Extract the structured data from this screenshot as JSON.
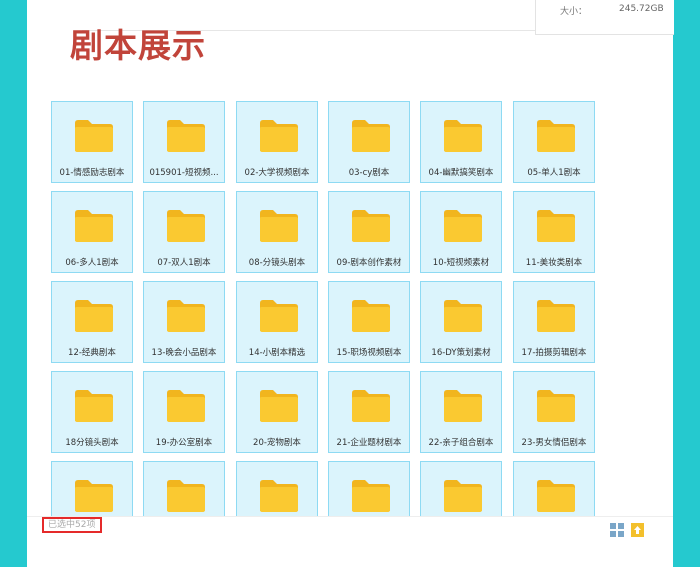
{
  "header": {
    "size_label": "大小：",
    "size_value": "245.72GB",
    "title": "剧本展示"
  },
  "folders": [
    {
      "label": "01-情感励志剧本"
    },
    {
      "label": "015901-短视频..."
    },
    {
      "label": "02-大学视频剧本"
    },
    {
      "label": "03-cy剧本"
    },
    {
      "label": "04-幽默搞笑剧本"
    },
    {
      "label": "05-单人1剧本"
    },
    {
      "label": "06-多人1剧本"
    },
    {
      "label": "07-双人1剧本"
    },
    {
      "label": "08-分镜头剧本"
    },
    {
      "label": "09-剧本创作素材"
    },
    {
      "label": "10-短视频素材"
    },
    {
      "label": "11-美妆类剧本"
    },
    {
      "label": "12-经典剧本"
    },
    {
      "label": "13-晚会小品剧本"
    },
    {
      "label": "14-小剧本精选"
    },
    {
      "label": "15-职场视频剧本"
    },
    {
      "label": "16-DY策划素材"
    },
    {
      "label": "17-拍摄剪辑剧本"
    },
    {
      "label": "18分镜头剧本"
    },
    {
      "label": "19-办公室剧本"
    },
    {
      "label": "20-宠物剧本"
    },
    {
      "label": "21-企业题材剧本"
    },
    {
      "label": "22-亲子组合剧本"
    },
    {
      "label": "23-男女情侣剧本"
    },
    {
      "label": ""
    },
    {
      "label": ""
    },
    {
      "label": ""
    },
    {
      "label": ""
    },
    {
      "label": ""
    },
    {
      "label": ""
    }
  ],
  "footer": {
    "status_text": "已选中52项",
    "grid_view_icon": "grid-view-icon",
    "upload_icon": "upload-icon"
  },
  "colors": {
    "background": "#25c9cf",
    "title": "#c1443a",
    "tile_bg": "#dbf4fc",
    "tile_border": "#8edaf3",
    "folder": "#f8c530",
    "highlight_border": "#e52a2a"
  }
}
